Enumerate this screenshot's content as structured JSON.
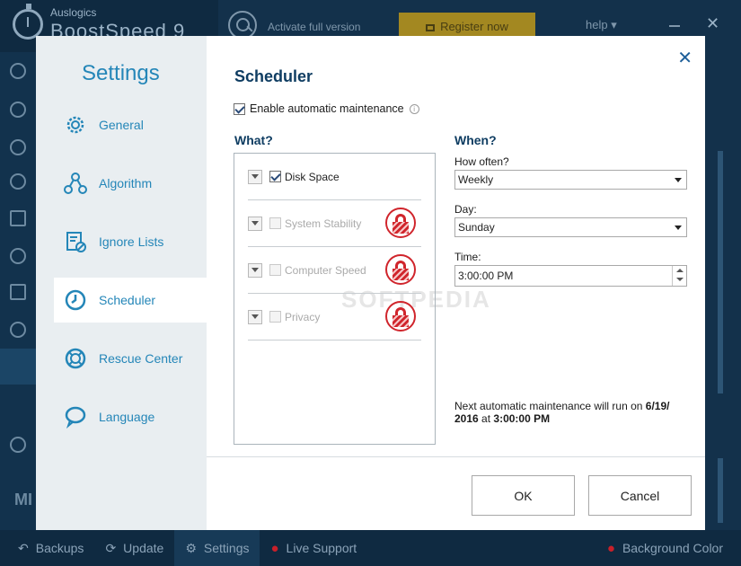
{
  "app": {
    "brand_small": "Auslogics",
    "brand_big": "BoostSpeed 9",
    "activate_text": "Activate full version",
    "register_label": "Register now",
    "help_label": "help ▾",
    "sidebar_bottom_text": "MI",
    "footer": [
      {
        "label": "Backups",
        "icon": "backups-icon"
      },
      {
        "label": "Update",
        "icon": "update-icon"
      },
      {
        "label": "Settings",
        "icon": "settings-gear-icon"
      },
      {
        "label": "Live Support",
        "icon": "warning-icon"
      },
      {
        "label": "Background Color",
        "icon": "warning-icon"
      }
    ]
  },
  "dialog": {
    "nav_title": "Settings",
    "nav_items": [
      {
        "label": "General",
        "icon": "gear-icon"
      },
      {
        "label": "Algorithm",
        "icon": "algorithm-icon"
      },
      {
        "label": "Ignore Lists",
        "icon": "ignore-list-icon"
      },
      {
        "label": "Scheduler",
        "icon": "clock-icon",
        "active": true
      },
      {
        "label": "Rescue Center",
        "icon": "lifebuoy-icon"
      },
      {
        "label": "Language",
        "icon": "speech-bubble-icon"
      }
    ],
    "page_title": "Scheduler",
    "enable_label": "Enable automatic maintenance",
    "what_heading": "What?",
    "what_items": [
      {
        "label": "Disk Space",
        "checked": true,
        "locked": false
      },
      {
        "label": "System Stability",
        "checked": false,
        "locked": true
      },
      {
        "label": "Computer Speed",
        "checked": false,
        "locked": true
      },
      {
        "label": "Privacy",
        "checked": false,
        "locked": true
      }
    ],
    "when_heading": "When?",
    "how_often_label": "How often?",
    "how_often_value": "Weekly",
    "day_label": "Day:",
    "day_value": "Sunday",
    "time_label": "Time:",
    "time_value": "3:00:00 PM",
    "next_run_prefix": "Next automatic maintenance will run on",
    "next_run_date": "6/19/",
    "next_run_date2": "2016",
    "next_run_at": "at",
    "next_run_time": "3:00:00 PM",
    "ok_label": "OK",
    "cancel_label": "Cancel",
    "close_symbol": "✕",
    "watermark": "SOFTPEDIA"
  },
  "colors": {
    "accent": "#2486b8",
    "heading": "#0f3d62",
    "lock_red": "#d0252c",
    "register_yellow": "#d4a514"
  }
}
